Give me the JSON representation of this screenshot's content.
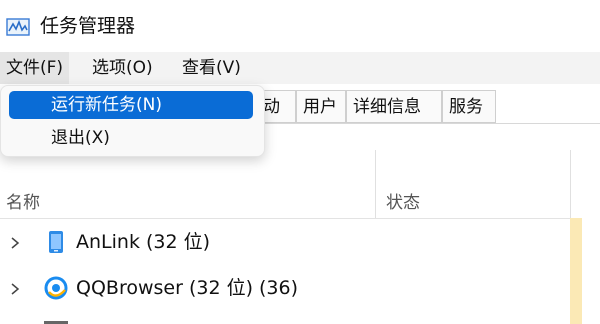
{
  "window": {
    "title": "任务管理器",
    "icon": "task-manager-icon"
  },
  "menu": {
    "items": [
      "文件(F)",
      "选项(O)",
      "查看(V)"
    ],
    "active_index": 0
  },
  "file_menu": {
    "items": [
      "运行新任务(N)",
      "退出(X)"
    ],
    "highlighted_index": 0
  },
  "tabs": [
    "动",
    "用户",
    "详细信息",
    "服务"
  ],
  "columns": {
    "name": "名称",
    "status": "状态"
  },
  "processes": [
    {
      "name": "AnLink (32 位)",
      "icon": "anlink-app-icon"
    },
    {
      "name": "QQBrowser (32 位) (36)",
      "icon": "qqbrowser-app-icon"
    }
  ],
  "colors": {
    "highlight": "#0a6cd6",
    "menubar": "#f3f3f3",
    "heat_strip": "#fbe9b5"
  }
}
